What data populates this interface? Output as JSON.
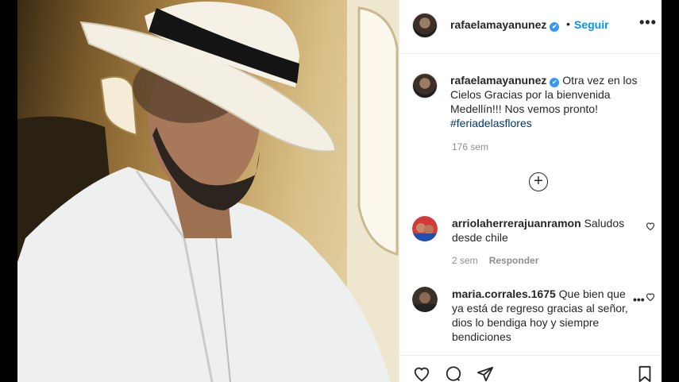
{
  "post": {
    "username": "rafaelamayanunez",
    "verified_mark": "✔",
    "separator": "•",
    "follow_label": "Seguir",
    "more_label": "•••"
  },
  "caption": {
    "username": "rafaelamayanunez",
    "text": "Otra vez en los Cielos Gracias por la bienvenida Medellín!!! Nos vemos pronto!",
    "hashtag": "#feriadelasflores",
    "time_ago": "176 sem"
  },
  "load_more_label": "+",
  "comments": [
    {
      "username": "arriolaherrerajuanramon",
      "text": "Saludos desde chile",
      "time_ago": "2 sem",
      "reply_label": "Responder"
    },
    {
      "username": "maria.corrales.1675",
      "text": "Que bien que ya está de regreso gracias al señor, dios lo bendiga hoy y siempre bendiciones",
      "more_label": "•••"
    }
  ],
  "icons": {
    "heart": "heart-icon",
    "comment": "comment-icon",
    "share": "share-icon",
    "bookmark": "bookmark-icon",
    "plus": "plus-circle-icon"
  },
  "colors": {
    "link": "#0095f6",
    "verified": "#3897f0",
    "hashtag": "#00376b",
    "muted": "#8e8e8e"
  }
}
